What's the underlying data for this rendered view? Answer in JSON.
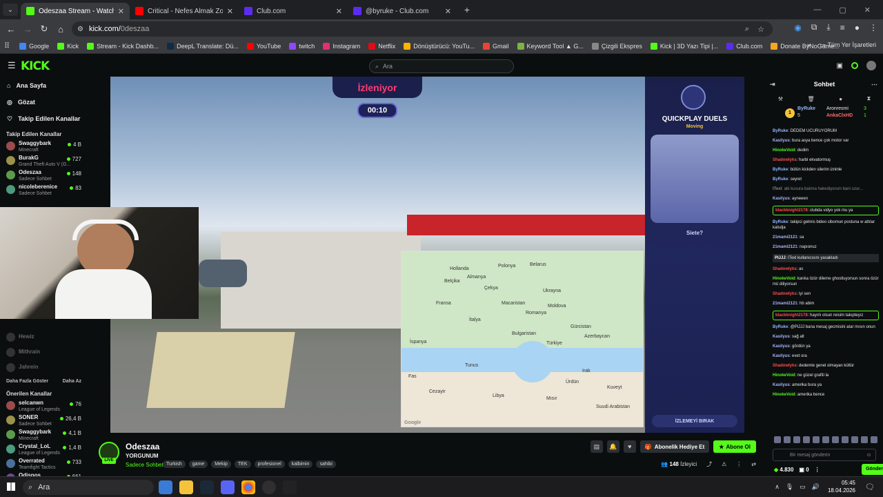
{
  "browser": {
    "tabs": [
      {
        "title": "Odeszaa Stream - Watch Live on",
        "active": true,
        "color": "#53fc18"
      },
      {
        "title": "Critical - Nefes Almak Zor |",
        "active": false,
        "color": "#ff0000"
      },
      {
        "title": "Club.com",
        "active": false,
        "color": "#5b2cf0"
      },
      {
        "title": "@byruke - Club.com",
        "active": false,
        "color": "#5b2cf0"
      }
    ],
    "url_host": "kick.com/",
    "url_path": "0deszaa",
    "bookmarks": [
      {
        "label": "Google",
        "color": "#4285f4"
      },
      {
        "label": "Kick",
        "color": "#53fc18"
      },
      {
        "label": "Stream - Kick Dashb...",
        "color": "#53fc18"
      },
      {
        "label": "DeepL Translate: Dü...",
        "color": "#0f2b46"
      },
      {
        "label": "YouTube",
        "color": "#ff0000"
      },
      {
        "label": "twitch",
        "color": "#9146ff"
      },
      {
        "label": "Instagram",
        "color": "#e1306c"
      },
      {
        "label": "Netflix",
        "color": "#e50914"
      },
      {
        "label": "Dönüştürücü: YouTu...",
        "color": "#ffb300"
      },
      {
        "label": "Gmail",
        "color": "#ea4335"
      },
      {
        "label": "Keyword Tool ▲ G...",
        "color": "#7cb342"
      },
      {
        "label": "Çizgili Ekspres",
        "color": "#888888"
      },
      {
        "label": "Kick | 3D Yazı Tipi |...",
        "color": "#53fc18"
      },
      {
        "label": "Club.com",
        "color": "#5b2cf0"
      },
      {
        "label": "Donate ByNoGame...",
        "color": "#f5a623"
      }
    ],
    "all_bookmarks": "Tüm Yer İşaretleri"
  },
  "kick": {
    "logo": "KICK",
    "search_placeholder": "Ara",
    "nav": [
      "Ana Sayfa",
      "Gözat",
      "Takip Edilen Kanallar"
    ],
    "followed_header": "Takip Edilen Kanallar",
    "followed": [
      {
        "name": "Swaggybark",
        "game": "Minecraft",
        "count": "4 B"
      },
      {
        "name": "BurakG",
        "game": "Grand Theft Auto V (G...",
        "count": "727"
      },
      {
        "name": "Odeszaa",
        "game": "Sadece Sohbet",
        "count": "148"
      },
      {
        "name": "nicoleberenice",
        "game": "Sadece Sohbet",
        "count": "83"
      }
    ],
    "offline": [
      "Hewiz",
      "Mithrain",
      "Jahrein"
    ],
    "show_more": "Daha Fazla Göster",
    "show_less": "Daha Az",
    "recommended_header": "Önerilen Kanallar",
    "recommended": [
      {
        "name": "selcanwn",
        "game": "League of Legends",
        "count": "76"
      },
      {
        "name": "SONER",
        "game": "Sadece Sohbet",
        "count": "26,4 B"
      },
      {
        "name": "Swaggybark",
        "game": "Minecraft",
        "count": "4,1 B"
      },
      {
        "name": "Crystal_LoL",
        "game": "League of Legends",
        "count": "1,4 B"
      },
      {
        "name": "Overrated",
        "game": "Teamfight Tactics",
        "count": "733"
      },
      {
        "name": "Odisnos",
        "game": "",
        "count": "661"
      }
    ]
  },
  "video": {
    "izleniyor": "İzleniyor",
    "timer": "00:10",
    "panel_title": "QUICKPLAY DUELS",
    "panel_sub": "Moving",
    "guess": "Siete?",
    "leave": "İZLEMEYİ BIRAK",
    "map_labels": [
      {
        "t": "Hollanda"
      },
      {
        "t": "Polonya"
      },
      {
        "t": "Belarus"
      },
      {
        "t": "Belçika"
      },
      {
        "t": "Almanya"
      },
      {
        "t": "Çekya"
      },
      {
        "t": "Ukrayna"
      },
      {
        "t": "Fransa"
      },
      {
        "t": "Macaristan"
      },
      {
        "t": "Moldova"
      },
      {
        "t": "Romanya"
      },
      {
        "t": "İtalya"
      },
      {
        "t": "Bulgaristan"
      },
      {
        "t": "Gürcistan"
      },
      {
        "t": "İspanya"
      },
      {
        "t": "Azerbaycan"
      },
      {
        "t": "Türkiye"
      },
      {
        "t": "Tunus"
      },
      {
        "t": "Fas"
      },
      {
        "t": "Irak"
      },
      {
        "t": "Cezayir"
      },
      {
        "t": "Libya"
      },
      {
        "t": "Ürdün"
      },
      {
        "t": "Kuveyt"
      },
      {
        "t": "Mısır"
      },
      {
        "t": "Suudi Arabistan"
      }
    ],
    "map_brand": "Google"
  },
  "stream": {
    "name": "Odeszaa",
    "title": "YORGUNUM",
    "category": "Sadece Sohbet",
    "tags": [
      "Turkish",
      "game",
      "Mekip",
      "TEK",
      "profesionel",
      "kalbimin",
      "sahibi"
    ],
    "gift": "Abonelik Hediye Et",
    "subscribe": "Abone Ol",
    "viewers": "148",
    "viewers_label": "İzleyici",
    "live": "LIVE"
  },
  "chat": {
    "title": "Sohbet",
    "pin_top_user": "ByRuke",
    "pin_top_count": "5",
    "pin_2_user": "Aronresmi",
    "pin_2_count": "3",
    "pin_3_user": "AnkaClxHD",
    "pin_3_count": "1",
    "messages": [
      {
        "u": "ByRuke",
        "c": "#8fb7ff",
        "t": "DEDEM UCURUYORUM",
        "k": ""
      },
      {
        "u": "Kasilyus",
        "c": "#a9b6ff",
        "t": "bura asya bence çok motor var",
        "k": ""
      },
      {
        "u": "HinokeVoid",
        "c": "#53fc18",
        "t": "dedim",
        "k": ""
      },
      {
        "u": "Shadowlyks",
        "c": "#ff4d4d",
        "t": "harbi ekvatormuş",
        "k": ""
      },
      {
        "u": "ByRuke",
        "c": "#8fb7ff",
        "t": "bütün kickden silerim izninle",
        "k": ""
      },
      {
        "u": "ByRuke",
        "c": "#8fb7ff",
        "t": "seyret",
        "k": ""
      },
      {
        "u": "ITexl",
        "c": "#888888",
        "t": "abi kusura bakma hakediyorum bani ozur...",
        "k": "dim"
      },
      {
        "u": "Kasilyus",
        "c": "#a9b6ff",
        "t": "ayneeen",
        "k": ""
      },
      {
        "u": "blackknight2178",
        "c": "#ff4d4d",
        "t": "clubda vidyo yok mu ya",
        "k": "hl"
      },
      {
        "u": "ByRuke",
        "c": "#8fb7ff",
        "t": "takipci gelmis bideo cibomun postuna w attılar kalsdja",
        "k": ""
      },
      {
        "u": "21mami2121",
        "c": "#a9b6ff",
        "t": "sa",
        "k": ""
      },
      {
        "u": "21mami2121",
        "c": "#a9b6ff",
        "t": "napıonuz",
        "k": ""
      },
      {
        "u": "PlJJJ",
        "c": "#ffffff",
        "t": "ITexl kullanıcısını yasakladı",
        "k": "sys"
      },
      {
        "u": "Shadowlyks",
        "c": "#ff4d4d",
        "t": "as",
        "k": ""
      },
      {
        "u": "HinokeVoid",
        "c": "#53fc18",
        "t": "kanka özür dileme ghostluyorsun sonra özür mü diliyorsun",
        "k": ""
      },
      {
        "u": "Shadowlyks",
        "c": "#ff4d4d",
        "t": "iyi sen",
        "k": ""
      },
      {
        "u": "21mami2121",
        "c": "#a9b6ff",
        "t": "hb abim",
        "k": ""
      },
      {
        "u": "blackknight2178",
        "c": "#ff4d4d",
        "t": "hayırlı olsun reisim takıpteyız",
        "k": "hl"
      },
      {
        "u": "ByRuke",
        "c": "#8fb7ff",
        "t": "@PlJJJ bana mesaj gecmisini atar mısın onun",
        "k": ""
      },
      {
        "u": "Kasilyus",
        "c": "#a9b6ff",
        "t": "sağ alt",
        "k": ""
      },
      {
        "u": "Kasilyus",
        "c": "#a9b6ff",
        "t": "gördün ya",
        "k": ""
      },
      {
        "u": "Kasilyus",
        "c": "#a9b6ff",
        "t": "evet ora",
        "k": ""
      },
      {
        "u": "Shadowlyks",
        "c": "#ff4d4d",
        "t": "dedemle genel olmayan kültür",
        "k": ""
      },
      {
        "u": "HinokeVoid",
        "c": "#53fc18",
        "t": "ne güzel grafiti la",
        "k": ""
      },
      {
        "u": "Kasilyus",
        "c": "#a9b6ff",
        "t": "amerika bura ya",
        "k": ""
      },
      {
        "u": "HinokeVoid",
        "c": "#53fc18",
        "t": "amerika bence",
        "k": ""
      }
    ],
    "input_placeholder": "Bir mesaj gönderin",
    "points": "4.830",
    "zero": "0",
    "send": "Gönder"
  },
  "taskbar": {
    "search": "Ara",
    "time": "05:45",
    "date": "18.04.2026"
  }
}
